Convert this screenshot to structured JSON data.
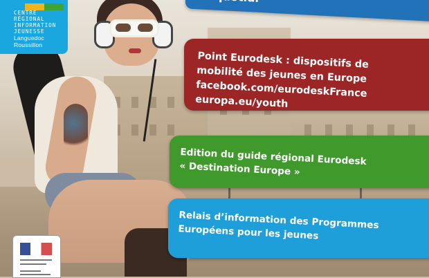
{
  "logo": {
    "line1": "CENTRE",
    "line2": "RÉGIONAL",
    "line3": "INFORMATION",
    "line4": "JEUNESSE",
    "line5": "Languedoc",
    "line6": "Roussillon",
    "square_colors": [
      "#f3b41b",
      "#3fa535"
    ]
  },
  "cards": {
    "top": {
      "text": "quotidi",
      "color": "#2172b9"
    },
    "eurodesk": {
      "line1": "Point Eurodesk : dispositifs de",
      "line2": "mobilité des jeunes en Europe",
      "line3": "facebook.com/eurodeskFrance",
      "line4": "europa.eu/youth",
      "color": "#9c2525"
    },
    "guide": {
      "line1": "Edition du guide régional Eurodesk",
      "line2": "« Destination Europe »",
      "color": "#3f9a2b"
    },
    "relais": {
      "line1": "Relais d’information des Programmes",
      "line2": "Européens pour les jeunes",
      "color": "#1e9fd9"
    }
  }
}
